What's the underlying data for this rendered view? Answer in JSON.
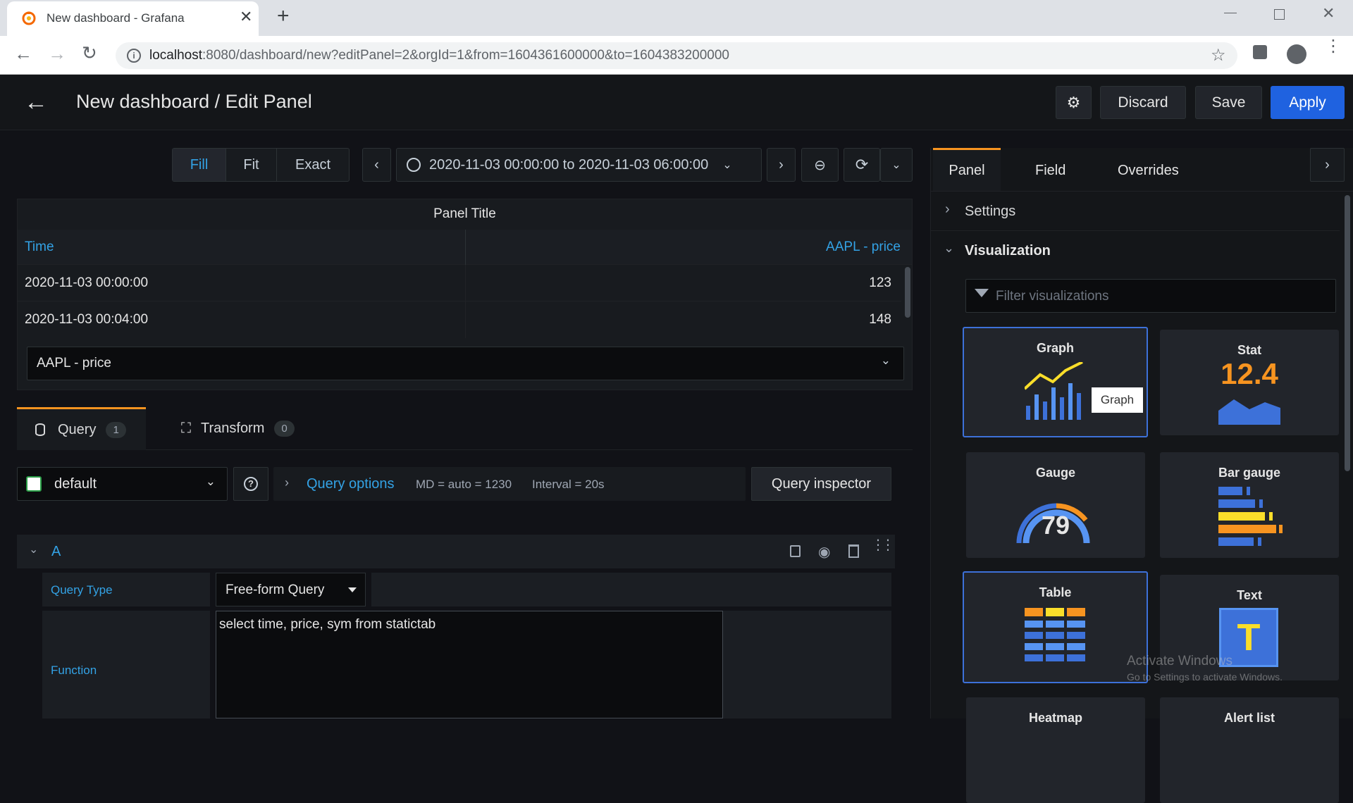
{
  "browser": {
    "tab_title": "New dashboard - Grafana",
    "url_host": "localhost",
    "url_rest": ":8080/dashboard/new?editPanel=2&orgId=1&from=1604361600000&to=1604383200000"
  },
  "header": {
    "title": "New dashboard / Edit Panel",
    "discard": "Discard",
    "save": "Save",
    "apply": "Apply"
  },
  "toolbar": {
    "fill": "Fill",
    "fit": "Fit",
    "exact": "Exact",
    "time_range": "2020-11-03 00:00:00 to 2020-11-03 06:00:00"
  },
  "panel": {
    "title": "Panel Title",
    "columns": [
      "Time",
      "AAPL - price"
    ],
    "rows": [
      [
        "2020-11-03 00:00:00",
        "123"
      ],
      [
        "2020-11-03 00:04:00",
        "148"
      ]
    ],
    "series_select": "AAPL - price"
  },
  "query_tabs": {
    "query": "Query",
    "query_count": "1",
    "transform": "Transform",
    "transform_count": "0"
  },
  "query_bar": {
    "datasource": "default",
    "query_options": "Query options",
    "md": "MD = auto = 1230",
    "interval": "Interval = 20s",
    "inspector": "Query inspector"
  },
  "query_a": {
    "ref": "A",
    "query_type_label": "Query Type",
    "query_type_value": "Free-form Query",
    "function_label": "Function",
    "function_value": "select time, price, sym from statictab"
  },
  "right_pane": {
    "tabs": [
      "Panel",
      "Field",
      "Overrides"
    ],
    "settings": "Settings",
    "visualization": "Visualization",
    "filter_placeholder": "Filter visualizations",
    "cards": [
      "Graph",
      "Stat",
      "Gauge",
      "Bar gauge",
      "Table",
      "Text",
      "Heatmap",
      "Alert list"
    ],
    "tooltip": "Graph",
    "stat_value": "12.4",
    "gauge_value": "79",
    "text_glyph": "T"
  },
  "watermark": {
    "line1": "Activate Windows",
    "line2": "Go to Settings to activate Windows."
  },
  "colors": {
    "accent_blue": "#3d71d9",
    "orange": "#f79420",
    "yellow": "#fade2a",
    "link_blue": "#33a2e5"
  }
}
